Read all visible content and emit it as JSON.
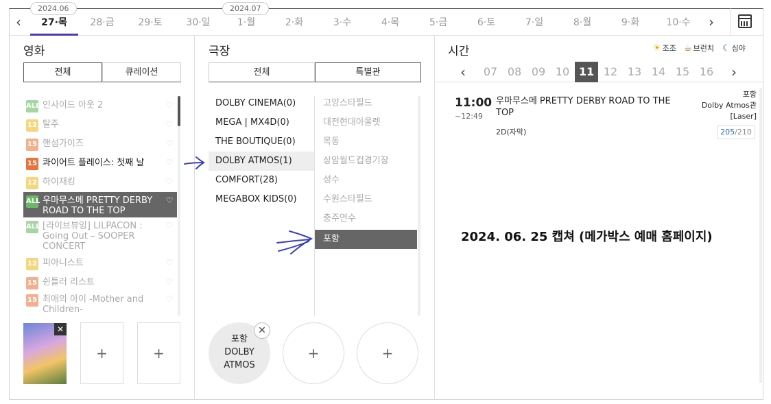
{
  "datebar": {
    "month_tags": [
      "2024.06",
      "2024.07"
    ],
    "days": [
      "27·목",
      "28·금",
      "29·토",
      "30·일",
      "1·월",
      "2·화",
      "3·수",
      "4·목",
      "5·금",
      "6·토",
      "7·일",
      "8·월",
      "9·화",
      "10·수"
    ],
    "prev": "‹",
    "next": "›"
  },
  "movies": {
    "title": "영화",
    "tabs": [
      "전체",
      "큐레이션"
    ],
    "items": [
      {
        "age": "ALL",
        "name": "인사이드 아웃 2"
      },
      {
        "age": "12",
        "name": "탈주"
      },
      {
        "age": "15",
        "name": "핸섬가이즈"
      },
      {
        "age": "15",
        "name": "콰이어트 플레이스: 첫째 날"
      },
      {
        "age": "12",
        "name": "하이재킹"
      },
      {
        "age": "ALL",
        "name": "우마무스메 PRETTY DERBY ROAD TO THE TOP"
      },
      {
        "age": "ALL",
        "name": "[라이브뷰잉] LILPACON : Going Out – SOOPER CONCERT"
      },
      {
        "age": "12",
        "name": "피아니스트"
      },
      {
        "age": "15",
        "name": "쉰들러 리스트"
      },
      {
        "age": "15",
        "name": "최애의 아이 -Mother and Children-"
      }
    ],
    "slot_plus": "+",
    "remove": "✕"
  },
  "theaters": {
    "title": "극장",
    "tabs": [
      "전체",
      "특별관"
    ],
    "special": [
      "DOLBY CINEMA(0)",
      "MEGA | MX4D(0)",
      "THE BOUTIQUE(0)",
      "DOLBY ATMOS(1)",
      "COMFORT(28)",
      "MEGABOX KIDS(0)"
    ],
    "locations": [
      "고양스타필드",
      "대전현대아울렛",
      "목동",
      "상암월드컵경기장",
      "성수",
      "수원스타필드",
      "충주연수",
      "포항"
    ],
    "picked": [
      "포항",
      "DOLBY",
      "ATMOS"
    ],
    "slot_plus": "+",
    "remove": "✕"
  },
  "time": {
    "title": "시간",
    "legend": [
      "조조",
      "브런치",
      "심야"
    ],
    "hours": [
      "07",
      "08",
      "09",
      "10",
      "11",
      "12",
      "13",
      "14",
      "15",
      "16"
    ],
    "prev": "‹",
    "next": "›",
    "show": {
      "start": "11:00",
      "end": "~12:49",
      "title": "우마무스메 PRETTY DERBY ROAD TO THE TOP",
      "format": "2D(자막)",
      "theater": [
        "포항",
        "Dolby Atmos관",
        "[Laser]"
      ],
      "seats_left": "205",
      "seats_total": "/210"
    }
  },
  "caption": "2024. 06. 25 캡쳐 (메가박스 예매 홈페이지)",
  "colors": {
    "age_all": "#6db867",
    "age_12": "#f0b81c",
    "age_15": "#e8743b",
    "accent": "#4a3ab3",
    "arrow": "#3b3fc4"
  }
}
